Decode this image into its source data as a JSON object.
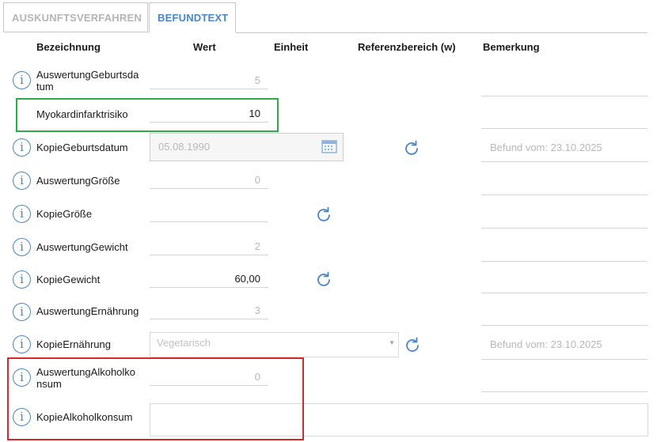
{
  "tabs": [
    {
      "label": "AUSKUNFTSVERFAHREN"
    },
    {
      "label": "BEFUNDTEXT"
    }
  ],
  "columns": {
    "bezeichnung": "Bezeichnung",
    "wert": "Wert",
    "einheit": "Einheit",
    "referenz": "Referenzbereich (w)",
    "bemerkung": "Bemerkung"
  },
  "rows": [
    {
      "label_line1": "AuswertungGeburtsda",
      "label_line2": "tum",
      "value": "5"
    },
    {
      "label": "Myokardinfarktrisiko",
      "value": "10"
    },
    {
      "label": "KopieGeburtsdatum",
      "value": "05.08.1990",
      "remark": "Befund vom: 23.10.2025"
    },
    {
      "label": "AuswertungGröße",
      "value": "0"
    },
    {
      "label": "KopieGröße",
      "value": ""
    },
    {
      "label": "AuswertungGewicht",
      "value": "2"
    },
    {
      "label": "KopieGewicht",
      "value": "60,00"
    },
    {
      "label": "AuswertungErnährung",
      "value": "3"
    },
    {
      "label": "KopieErnährung",
      "value": "Vegetarisch",
      "remark": "Befund vom: 23.10.2025"
    },
    {
      "label_line1": "AuswertungAlkoholko",
      "label_line2": "nsum",
      "value": "0"
    },
    {
      "label": "KopieAlkoholkonsum",
      "value": ""
    }
  ],
  "colors": {
    "accent": "#4a86c5",
    "highlight_green": "#2ea84a",
    "highlight_red": "#d32a2a"
  },
  "icons": {
    "info": "info-icon",
    "refresh": "refresh-icon",
    "calendar": "calendar-icon",
    "dropdown": "chevron-down-icon"
  }
}
